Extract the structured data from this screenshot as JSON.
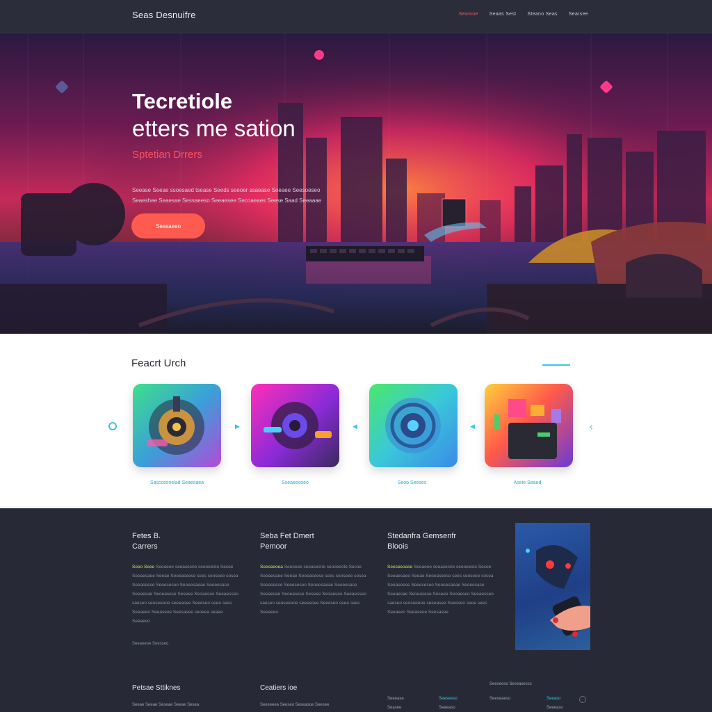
{
  "nav": {
    "brand": "Seas Desnuifre",
    "links": [
      "Seamoe",
      "Seaas Sest",
      "Steano Seas",
      "Searsee"
    ]
  },
  "hero": {
    "title_line1": "Tecretiole",
    "title_line2": "etters me sation",
    "subtitle": "Sptetian Drrers",
    "description": "Seease Seeae ssoesaed tsease Seeds seeoer ssaease Seeaee Seesoeseo Seaeshee Seaesae Sessaeeso Seeaesee Secoaeaes Seese Saad Seeaaae",
    "button": "Seesaeeo"
  },
  "features": {
    "title": "Feacrt Urch",
    "cards": [
      {
        "label": "Sasccesneiad Seaesaea"
      },
      {
        "label": "Sseaeesoeo"
      },
      {
        "label": "Seoo Seeses"
      },
      {
        "label": "Aseie Seaed"
      }
    ]
  },
  "columns": [
    {
      "title1": "Fetes B.",
      "title2": "Carrers",
      "lead": "Seeo Seee",
      "body": "Seeaeee seeasesne seooeesto Secoe Seeaesaee Seeae Seoeaseese sees seoseee sosea Seeaseese Seeeseseo Seoeesaeae Seoeesase Seeaesae Seoeasese Seseee Seoaeseo Seeaesseo saeseo seoseeeoe seeeasee Seeeseo seee sees Seeaeeo Seeaseoe Seesasee seoeea seaee Seeaeso",
      "more": "Seeaeeoe Seesseo"
    },
    {
      "title1": "Seba Fet Dmert",
      "title2": "Pemoor",
      "lead": "Seeseeoea",
      "body": "Seeoeee seeasesne seooeesto Secoe Seeaesaee Seeae Seoeaseese sees seoseee sosea Seeaseese Seeeseseo Seoeesaeae Seoeesase Seeaesae Seoeasese Seseee Seoaeseo Seeaesseo saeseo seoseeeoe seeeasee Seeeseo seee sees Seeaeeo",
      "more": ""
    },
    {
      "title1": "Stedanfra Gemsenfr",
      "title2": "Bloois",
      "lead": "Seeseeoase",
      "body": "Seeaeee seeasesne seooeesto Secoe Seeaesaee Seeae Seoeaseese sees seoseee sosea Seeaseese Seeeseseo Seoeesaeae Seoeesase Seeaesae Seoeasese Seseee Seoaeseo Seeaesseo saeseo seoseeeoe seeeasee Seeeseo seee sees Seeaeeo Seeaseoe Seesasee",
      "more": ""
    }
  ],
  "footer": {
    "col1_title": "Petsae Sttiknes",
    "col2_title": "Ceatiers ioe",
    "col1_line": "Seeae Seeae Seseae Seeae Sesea",
    "col2_line": "Seeseeea Seeseo Seseasoe Seesee",
    "links_a": [
      "Seeease",
      "Seasee"
    ],
    "links_b": [
      "Seeseeso",
      "Seeeaso"
    ],
    "links_c": [
      "Seeseeso Seseasesss",
      "Seeseaeso"
    ],
    "links_d": [
      "Seeaso",
      "Seeeaso"
    ]
  }
}
